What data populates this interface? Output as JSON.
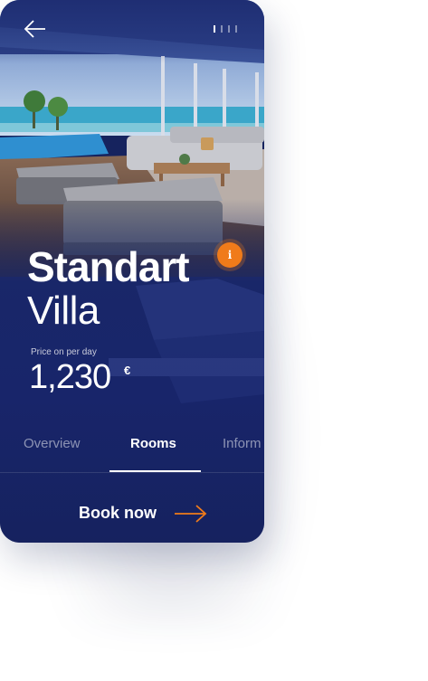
{
  "header": {
    "back_icon": "arrow-left-icon",
    "pager": {
      "count": 4,
      "active_index": 0
    }
  },
  "villa": {
    "title_bold": "Standart",
    "title_light": "Villa",
    "info_icon": "info-icon",
    "info_glyph": "i"
  },
  "price": {
    "caption": "Price on per day",
    "value": "1,230",
    "currency": "€"
  },
  "tabs": [
    {
      "label": "Overview"
    },
    {
      "label": "Rooms"
    },
    {
      "label": "Inform"
    }
  ],
  "active_tab": "Rooms",
  "cta": {
    "label": "Book now",
    "arrow_icon": "arrow-right-icon"
  },
  "colors": {
    "panel_navy": "#18256a",
    "accent_orange": "#f07b1a",
    "text_white": "#ffffff"
  }
}
